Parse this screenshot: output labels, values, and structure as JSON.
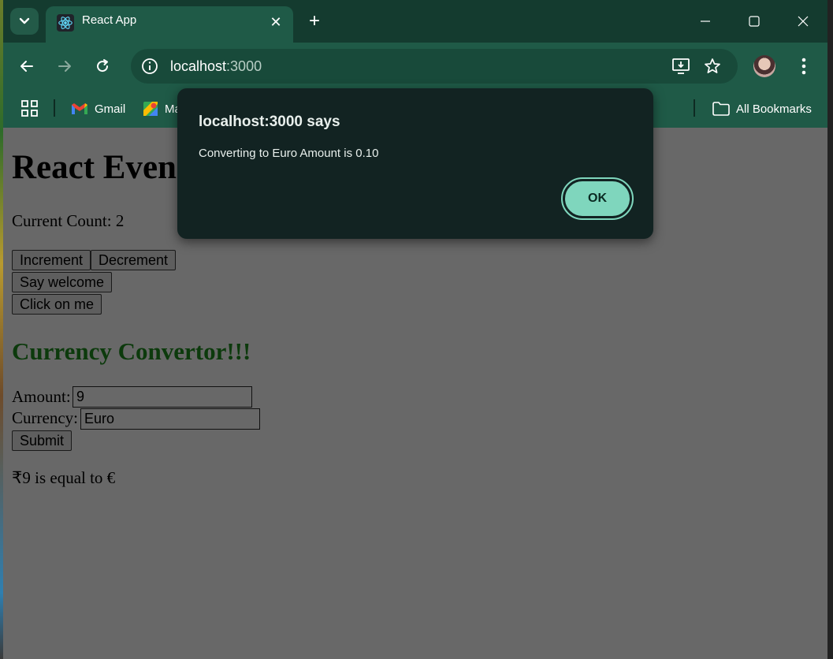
{
  "browser": {
    "tab_title": "React App",
    "url_host": "localhost",
    "url_port": ":3000",
    "bookmarks": {
      "gmail": "Gmail",
      "maps": "Ma",
      "all_bookmarks": "All Bookmarks"
    },
    "colors": {
      "frame": "#143b2f",
      "toolbar": "#1f5a47"
    }
  },
  "page": {
    "heading": "React Even",
    "current_count": "Current Count: 2",
    "buttons": {
      "increment": "Increment",
      "decrement": "Decrement",
      "say_welcome": "Say welcome",
      "click_on_me": "Click on me",
      "submit": "Submit"
    },
    "currency": {
      "heading": "Currency Convertor!!!",
      "amount_label": "Amount:",
      "amount_value": "9",
      "currency_label": "Currency:",
      "currency_value": "Euro",
      "result": "₹9 is equal to €"
    }
  },
  "dialog": {
    "title": "localhost:3000 says",
    "message": "Converting to Euro Amount is 0.10",
    "ok_label": "OK"
  }
}
